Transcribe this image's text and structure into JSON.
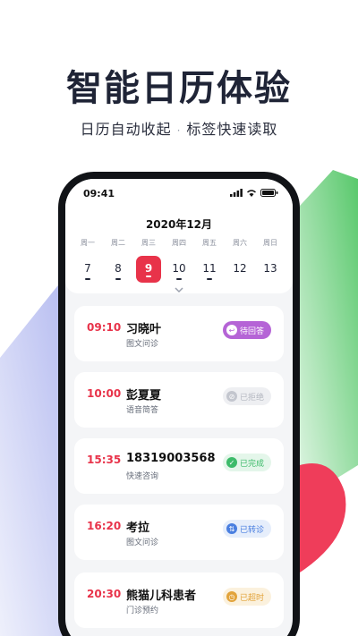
{
  "headline": "智能日历体验",
  "subheadline": {
    "left": "日历自动收起",
    "separator": "·",
    "right": "标签快速读取"
  },
  "status_bar": {
    "time": "09:41"
  },
  "calendar": {
    "month": "2020年12月",
    "weekdays": [
      "周一",
      "周二",
      "周三",
      "周四",
      "周五",
      "周六",
      "周日"
    ],
    "dates": [
      "7",
      "8",
      "9",
      "10",
      "11",
      "12",
      "13"
    ],
    "selected_date": "9"
  },
  "appointments": [
    {
      "time": "09:10",
      "name": "习晓叶",
      "type": "图文问诊",
      "status": "待回答",
      "status_icon": "reply-icon"
    },
    {
      "time": "10:00",
      "name": "彭夏夏",
      "type": "语音简答",
      "status": "已拒绝",
      "status_icon": "declined-icon"
    },
    {
      "time": "15:35",
      "name": "18319003568",
      "type": "快速咨询",
      "status": "已完成",
      "status_icon": "check-icon"
    },
    {
      "time": "16:20",
      "name": "考拉",
      "type": "图文问诊",
      "status": "已转诊",
      "status_icon": "transfer-icon"
    },
    {
      "time": "20:30",
      "name": "熊猫儿科患者",
      "type": "门诊预约",
      "status": "已超时",
      "status_icon": "clock-icon"
    }
  ],
  "colors": {
    "accent_red": "#e8334a",
    "headline_text": "#1f2436",
    "pending_purple": "#b564d6",
    "declined_gray": "#c3c6ce",
    "done_green": "#3dbb6a",
    "transfer_blue": "#4a7fe0",
    "timeout_orange": "#e2a33a",
    "decor_blue": "#c9cdf3",
    "decor_green": "#5fcf6f",
    "decor_pink": "#ef3d5a"
  }
}
